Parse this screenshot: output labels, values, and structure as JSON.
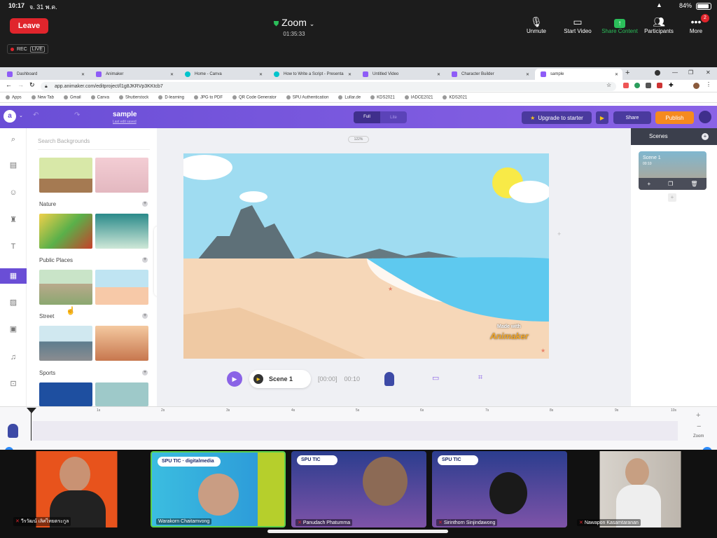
{
  "status": {
    "time": "10:17",
    "date": "จ. 31 พ.ค.",
    "battery": "84%"
  },
  "zoom": {
    "leave_label": "Leave",
    "title": "Zoom",
    "elapsed": "01:35:33",
    "rec_label": "REC",
    "live_label": "LIVE",
    "controls": [
      {
        "label": "Unmute",
        "icon": "mic-off-icon"
      },
      {
        "label": "Start Video",
        "icon": "video-off-icon"
      },
      {
        "label": "Share Content",
        "icon": "share-screen-icon"
      },
      {
        "label": "Participants",
        "icon": "participants-icon"
      },
      {
        "label": "More",
        "icon": "more-icon"
      }
    ],
    "more_badge": "2"
  },
  "browser": {
    "tabs": [
      "Dashboard",
      "Animaker",
      "Home - Canva",
      "How to Write a Script - Presenta",
      "Untitled Video",
      "Character Builder",
      "sample"
    ],
    "active_tab": 6,
    "url": "app.animaker.com/editproject/l1g8JKRVp3KKtcb7",
    "bookmarks": [
      "Apps",
      "New Tab",
      "Gmail",
      "Canva",
      "Shutterstock",
      "D-learning",
      "JPG to PDF",
      "QR Code Generator",
      "SPU Authentication",
      "Lullar.de",
      "KDS2021",
      "IADCE2021",
      "KDS2021"
    ]
  },
  "animaker": {
    "project_name": "sample",
    "project_sub": "Last edit saved",
    "view_full": "Full",
    "view_lite": "Lite",
    "upgrade_label": "Upgrade to starter",
    "share_label": "Share",
    "publish_label": "Publish",
    "search_placeholder": "Search Backgrounds",
    "categories": [
      "Nature",
      "Public Places",
      "Street",
      "Sports"
    ],
    "zoom_level": "122%",
    "scene_chip": "Scene 1",
    "time_current": "[00:00]",
    "time_total": "00:10",
    "scenes_title": "Scenes",
    "scene_card_name": "Scene 1",
    "scene_card_time": "00:10",
    "watermark_top": "Made with",
    "watermark_brand": "Animaker",
    "timeline_ticks": [
      "1s",
      "2s",
      "3s",
      "4s",
      "5s",
      "6s",
      "7s",
      "8s",
      "9s",
      "10s"
    ],
    "timeline_zoom_label": "Zoom"
  },
  "participants": [
    {
      "name": "วีรวัฒน์ เลิศไทยตระกูล",
      "muted": true
    },
    {
      "name": "Warakorn Chaitamvong",
      "muted": false
    },
    {
      "name": "Panudach Phatumma",
      "muted": true
    },
    {
      "name": "Sirinthorn Sinjindawong",
      "muted": true
    },
    {
      "name": "Nawapon Kasamtaranan",
      "muted": true
    }
  ],
  "colors": {
    "brand": "#6a4ed6",
    "publish": "#f58a1f",
    "leave": "#e0252c",
    "share_content": "#2bbf5a"
  }
}
